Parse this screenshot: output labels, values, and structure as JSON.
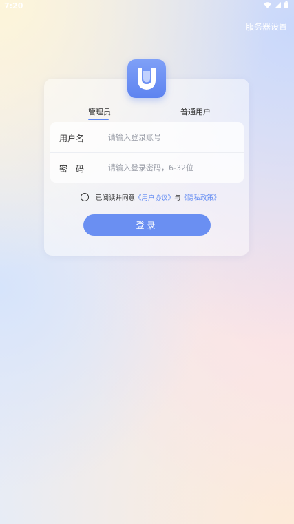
{
  "status_bar": {
    "time": "7:20"
  },
  "header": {
    "server_settings": "服务器设置"
  },
  "tabs": [
    {
      "label": "管理员",
      "active": true
    },
    {
      "label": "普通用户",
      "active": false
    }
  ],
  "form": {
    "username": {
      "label": "用户名",
      "value": "",
      "placeholder": "请输入登录账号"
    },
    "password": {
      "label": "密　码",
      "value": "",
      "placeholder": "请输入登录密码，6-32位"
    }
  },
  "agreement": {
    "checked": false,
    "prefix": "已阅读并同意",
    "user_agreement": "《用户协议》",
    "conjunction": "与",
    "privacy_policy": "《隐私政策》"
  },
  "login_button": "登录",
  "colors": {
    "accent": "#5b86f3",
    "button": "#6a8ff2"
  }
}
